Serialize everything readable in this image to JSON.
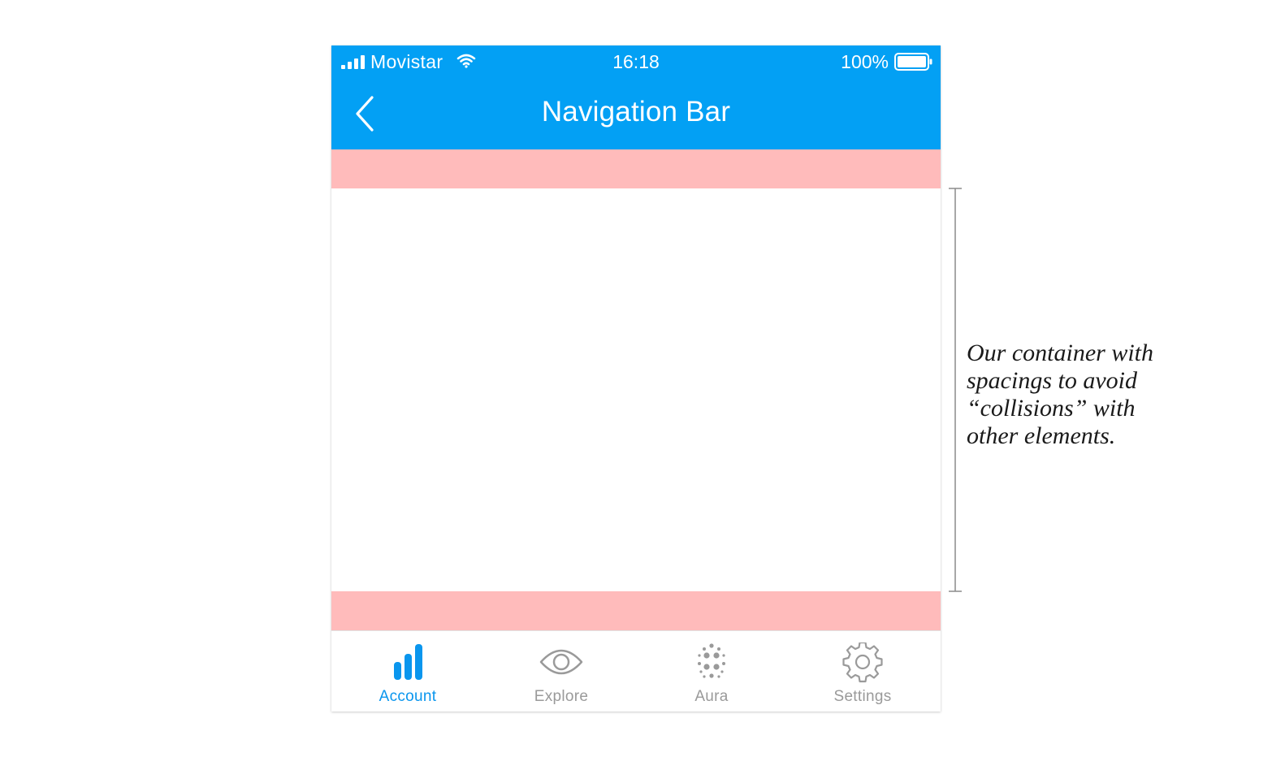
{
  "status_bar": {
    "carrier": "Movistar",
    "time": "16:18",
    "battery_percent": "100%",
    "signal_bars": 4,
    "battery_level": 1.0
  },
  "nav_bar": {
    "title": "Navigation Bar",
    "back_icon": "chevron-left-icon"
  },
  "tab_bar": {
    "tabs": [
      {
        "label": "Account",
        "icon": "bar-chart-icon",
        "active": true
      },
      {
        "label": "Explore",
        "icon": "eye-icon",
        "active": false
      },
      {
        "label": "Aura",
        "icon": "dots-cluster-icon",
        "active": false
      },
      {
        "label": "Settings",
        "icon": "gear-icon",
        "active": false
      }
    ]
  },
  "annotation": {
    "lines": [
      "Our container with",
      "spacings to avoid",
      "“collisions” with",
      "other elements."
    ]
  },
  "colors": {
    "header_bg": "#03A0F4",
    "spacer": "#FFBBBB",
    "active_tab": "#0A96EE",
    "inactive_tab": "#9a9a9a"
  }
}
